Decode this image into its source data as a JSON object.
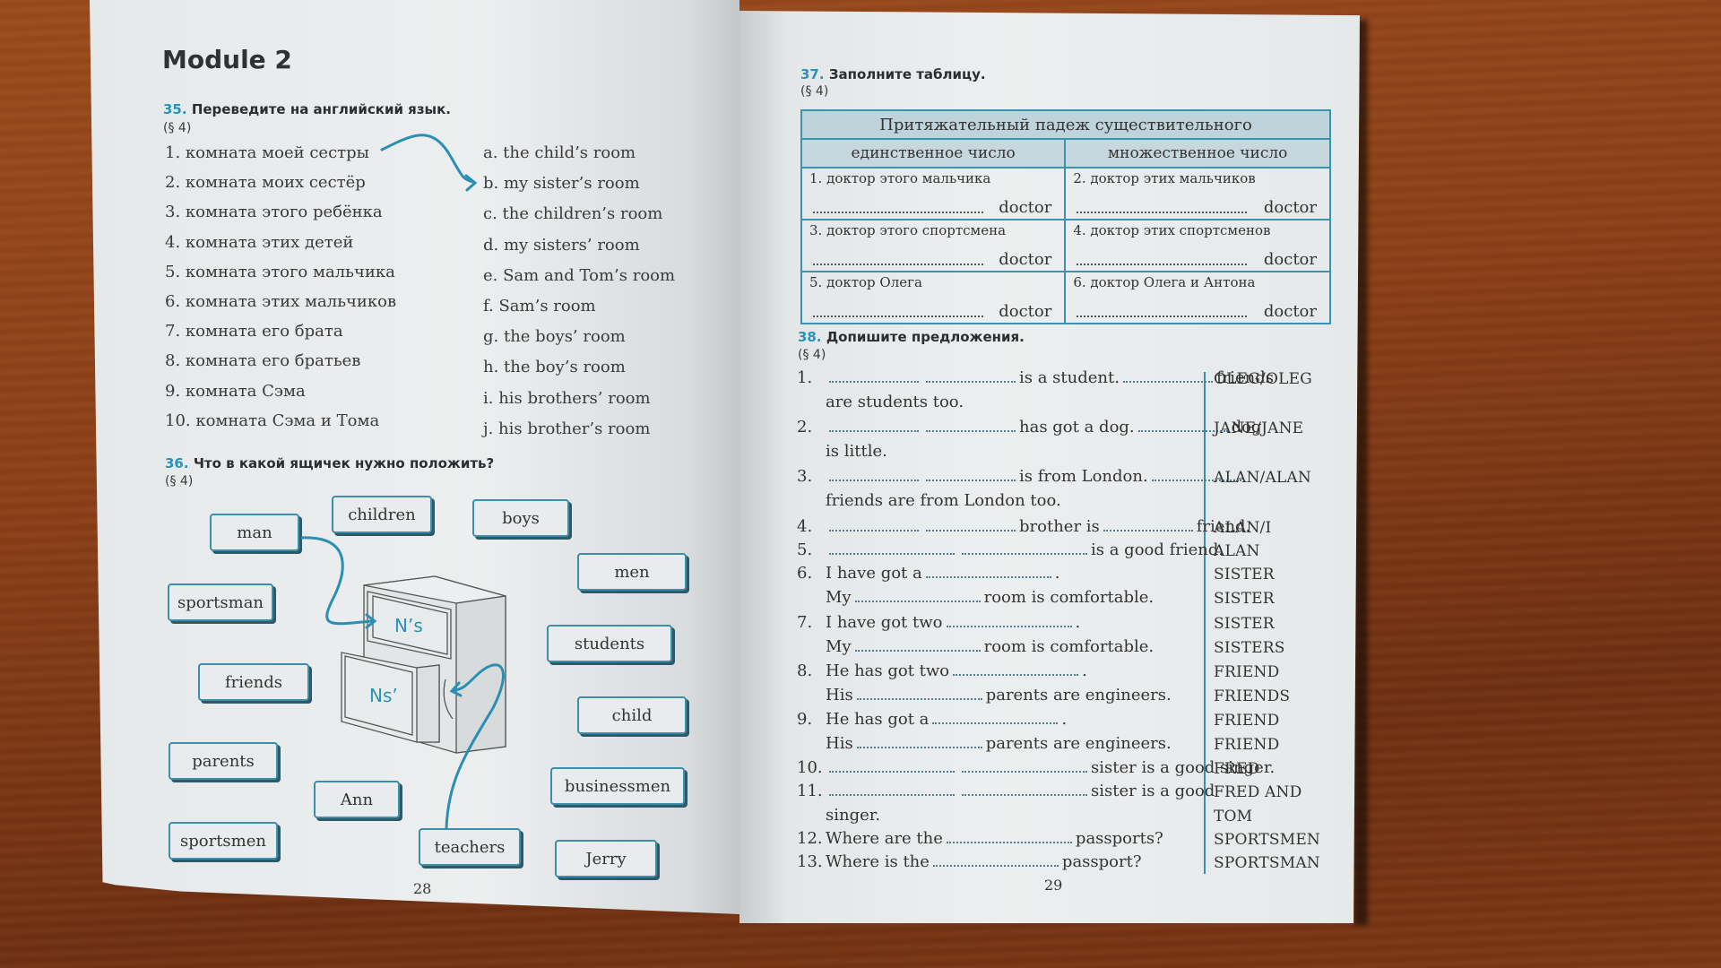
{
  "left_page": {
    "module_title": "Module 2",
    "page_number": "28",
    "exercise35": {
      "number": "35.",
      "instruction": "Переведите на английский язык.",
      "paragraph": "(§ 4)",
      "russian_items": [
        "1. комната моей сестры",
        "2. комната моих сестёр",
        "3. комната этого ребёнка",
        "4. комната этих детей",
        "5. комната этого мальчика",
        "6. комната этих мальчиков",
        "7. комната его брата",
        "8. комната его братьев",
        "9. комната Сэма",
        "10. комната Сэма и Тома"
      ],
      "english_items": [
        "a. the child’s room",
        "b. my sister’s room",
        "c. the children’s room",
        "d. my sisters’ room",
        "e. Sam and Tom’s room",
        "f. Sam’s room",
        "g. the boys’ room",
        "h. the boy’s room",
        "i. his brothers’ room",
        "j. his brother’s room"
      ],
      "example_link": {
        "from": "1",
        "to": "b"
      }
    },
    "exercise36": {
      "number": "36.",
      "instruction": "Что в какой ящичек нужно положить?",
      "paragraph": "(§ 4)",
      "drawer_top_label": "N’s",
      "drawer_bottom_label": "Ns’",
      "word_cards": [
        "man",
        "children",
        "boys",
        "men",
        "sportsman",
        "students",
        "friends",
        "child",
        "parents",
        "Ann",
        "businessmen",
        "sportsmen",
        "teachers",
        "Jerry"
      ]
    }
  },
  "right_page": {
    "page_number": "29",
    "exercise37": {
      "number": "37.",
      "instruction": "Заполните таблицу.",
      "paragraph": "(§ 4)",
      "table_title": "Притяжательный падеж существительного",
      "col_singular": "единственное число",
      "col_plural": "множественное число",
      "rows": [
        {
          "singular": "1. доктор этого мальчика",
          "plural": "2. доктор этих мальчиков"
        },
        {
          "singular": "3. доктор этого спортсмена",
          "plural": "4. доктор этих спортсменов"
        },
        {
          "singular": "5. доктор Олега",
          "plural": "6. доктор Олега и Антона"
        }
      ],
      "answer_suffix": "doctor"
    },
    "exercise38": {
      "number": "38.",
      "instruction": "Допишите предложения.",
      "paragraph": "(§ 4)",
      "lines": [
        {
          "num": "1.",
          "parts": [
            "",
            "is a student.",
            "friends"
          ],
          "hint": "OLEG/OLEG"
        },
        {
          "num": "",
          "parts": [
            "are students too."
          ],
          "hint": ""
        },
        {
          "num": "2.",
          "parts": [
            "",
            "has got a dog.",
            "dog"
          ],
          "hint": "JANE/JANE"
        },
        {
          "num": "",
          "parts": [
            "is little."
          ],
          "hint": ""
        },
        {
          "num": "3.",
          "parts": [
            "",
            "is from London.",
            ""
          ],
          "hint": "ALAN/ALAN"
        },
        {
          "num": "",
          "parts": [
            "friends are from London too."
          ],
          "hint": ""
        },
        {
          "num": "4.",
          "parts": [
            "",
            "brother is",
            "friend."
          ],
          "hint": "ALAN/I"
        },
        {
          "num": "5.",
          "parts": [
            "",
            "is a good friend."
          ],
          "hint": "ALAN"
        },
        {
          "num": "6.",
          "parts": [
            "I have got a",
            "."
          ],
          "hint": "SISTER"
        },
        {
          "num": "",
          "parts": [
            "My",
            "room is comfortable."
          ],
          "hint": "SISTER"
        },
        {
          "num": "7.",
          "parts": [
            "I have got two",
            "."
          ],
          "hint": "SISTER"
        },
        {
          "num": "",
          "parts": [
            "My",
            "room is comfortable."
          ],
          "hint": "SISTERS"
        },
        {
          "num": "8.",
          "parts": [
            "He has got two",
            "."
          ],
          "hint": "FRIEND"
        },
        {
          "num": "",
          "parts": [
            "His",
            "parents are engineers."
          ],
          "hint": "FRIENDS"
        },
        {
          "num": "9.",
          "parts": [
            "He has got a",
            "."
          ],
          "hint": "FRIEND"
        },
        {
          "num": "",
          "parts": [
            "His",
            "parents are engineers."
          ],
          "hint": "FRIEND"
        },
        {
          "num": "10.",
          "parts": [
            "",
            "sister is a good singer."
          ],
          "hint": "FRED"
        },
        {
          "num": "11.",
          "parts": [
            "",
            "sister is a good"
          ],
          "hint": "FRED AND"
        },
        {
          "num": "",
          "parts": [
            "singer."
          ],
          "hint": "TOM"
        },
        {
          "num": "12.",
          "parts": [
            "Where are the",
            "passports?"
          ],
          "hint": "SPORTSMEN"
        },
        {
          "num": "13.",
          "parts": [
            "Where is the",
            "passport?"
          ],
          "hint": "SPORTSMAN"
        }
      ]
    }
  },
  "colors": {
    "accent_teal": "#2a93b7",
    "table_header_bg": "#bed3da",
    "paper": "#eceeef",
    "desk": "#8a3e17"
  }
}
